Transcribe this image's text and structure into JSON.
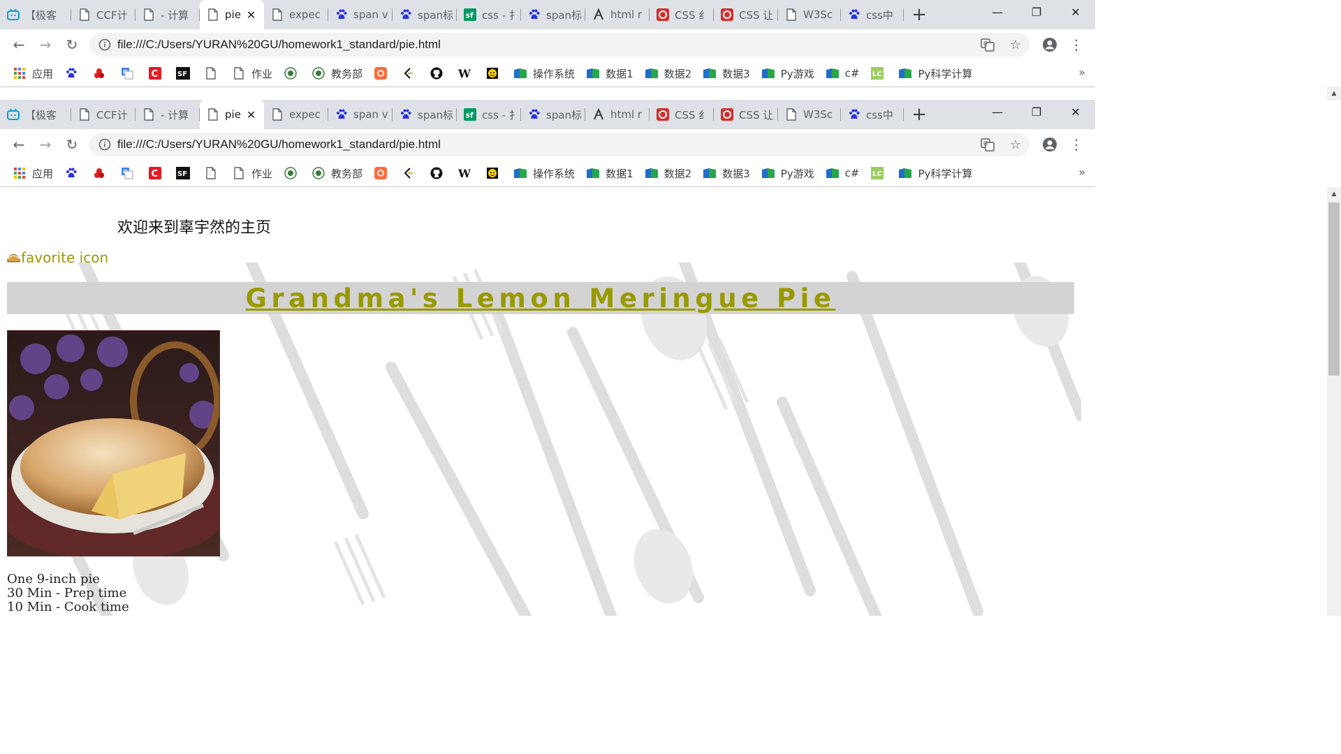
{
  "tabs": [
    {
      "label": "【极客",
      "icon": "bilibili-icon"
    },
    {
      "label": "CCF计",
      "icon": "page-icon"
    },
    {
      "label": "- 计算",
      "icon": "page-icon"
    },
    {
      "label": "pie",
      "icon": "page-icon",
      "active": true
    },
    {
      "label": "expec",
      "icon": "page-icon"
    },
    {
      "label": "span v",
      "icon": "baidu-paw-icon"
    },
    {
      "label": "span标",
      "icon": "baidu-paw-icon"
    },
    {
      "label": "css - 扌",
      "icon": "segmentfault-icon"
    },
    {
      "label": "span标",
      "icon": "baidu-paw-icon"
    },
    {
      "label": "html r",
      "icon": "html-icon"
    },
    {
      "label": "CSS 纟",
      "icon": "runoob-icon"
    },
    {
      "label": "CSS 让",
      "icon": "runoob-icon"
    },
    {
      "label": "W3Sc",
      "icon": "page-icon"
    },
    {
      "label": "css中",
      "icon": "baidu-paw-icon"
    }
  ],
  "address": {
    "url": "file:///C:/Users/YURAN%20GU/homework1_standard/pie.html"
  },
  "bookmarks": [
    {
      "label": "应用",
      "icon": "apps-grid-icon"
    },
    {
      "label": "",
      "icon": "baidu-paw-icon"
    },
    {
      "label": "",
      "icon": "red-logo-icon"
    },
    {
      "label": "",
      "icon": "translate-icon"
    },
    {
      "label": "",
      "icon": "csdn-icon"
    },
    {
      "label": "",
      "icon": "sf-icon"
    },
    {
      "label": "",
      "icon": "page-icon"
    },
    {
      "label": "作业",
      "icon": "page-icon"
    },
    {
      "label": "",
      "icon": "university-icon"
    },
    {
      "label": "教务部",
      "icon": "university-icon"
    },
    {
      "label": "",
      "icon": "orange-logo-icon"
    },
    {
      "label": "",
      "icon": "leetcode-icon"
    },
    {
      "label": "",
      "icon": "github-icon"
    },
    {
      "label": "",
      "icon": "wikipedia-icon"
    },
    {
      "label": "",
      "icon": "smiley-icon"
    },
    {
      "label": "操作系统",
      "icon": "folder-icon"
    },
    {
      "label": "数据1",
      "icon": "folder-icon"
    },
    {
      "label": "数据2",
      "icon": "folder-icon"
    },
    {
      "label": "数据3",
      "icon": "folder-icon"
    },
    {
      "label": "Py游戏",
      "icon": "folder-icon"
    },
    {
      "label": "c#",
      "icon": "folder-icon"
    },
    {
      "label": "",
      "icon": "code-icon"
    },
    {
      "label": "Py科学计算",
      "icon": "folder-icon"
    }
  ],
  "bookmarks_more": "»",
  "page": {
    "welcome": "欢迎来到辜宇然的主页",
    "favicon_label": "favorite icon",
    "heading": "Grandma's Lemon Meringue Pie",
    "recipe": [
      "One 9-inch pie",
      "30 Min - Prep time",
      "10 Min - Cook time"
    ]
  },
  "colors": {
    "heading": "#999900",
    "banner_bg": "#d3d3d3",
    "link_olive": "#999900"
  }
}
